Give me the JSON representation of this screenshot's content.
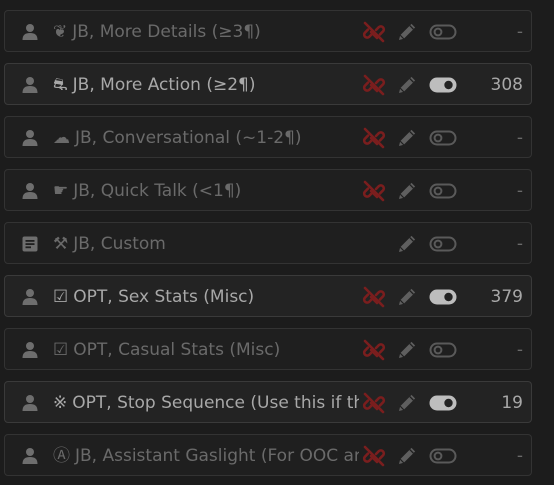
{
  "colors": {
    "background": "#1c1c1c",
    "row_border": "#333333",
    "text_dim": "#6a6a6a",
    "text_active": "#a8a8a8",
    "unlink_red": "#7a1e1e",
    "toggle_on": "#bdbdbd",
    "toggle_off": "#5a5a5a"
  },
  "rows": [
    {
      "lead_icon": "user-icon",
      "glyph": "❦",
      "name": "JB, More Details (≥3¶)",
      "unlink": true,
      "enabled": false,
      "count": "-"
    },
    {
      "lead_icon": "user-icon",
      "glyph": "⛐",
      "name": "JB, More Action (≥2¶)",
      "unlink": true,
      "enabled": true,
      "count": "308"
    },
    {
      "lead_icon": "user-icon",
      "glyph": "☁",
      "name": "JB, Conversational (~1-2¶)",
      "unlink": true,
      "enabled": false,
      "count": "-"
    },
    {
      "lead_icon": "user-icon",
      "glyph": "☛",
      "name": "JB, Quick Talk (<1¶)",
      "unlink": true,
      "enabled": false,
      "count": "-"
    },
    {
      "lead_icon": "document-icon",
      "glyph": "⚒",
      "name": "JB, Custom",
      "unlink": false,
      "enabled": false,
      "count": "-"
    },
    {
      "lead_icon": "user-icon",
      "glyph": "☑",
      "name": "OPT, Sex Stats (Misc)",
      "unlink": true,
      "enabled": true,
      "count": "379"
    },
    {
      "lead_icon": "user-icon",
      "glyph": "☑",
      "name": "OPT, Casual Stats (Misc)",
      "unlink": true,
      "enabled": false,
      "count": "-"
    },
    {
      "lead_icon": "user-icon",
      "glyph": "※",
      "name": "OPT, Stop Sequence (Use this if th",
      "unlink": true,
      "enabled": true,
      "count": "19"
    },
    {
      "lead_icon": "user-icon",
      "glyph": "Ⓐ",
      "name": "JB, Assistant Gaslight (For OOC ar",
      "unlink": true,
      "enabled": false,
      "count": "-"
    }
  ]
}
